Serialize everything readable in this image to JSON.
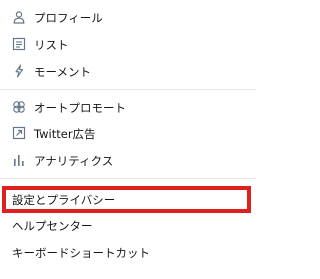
{
  "menu": {
    "items": [
      {
        "label": "プロフィール",
        "icon": "person-icon"
      },
      {
        "label": "リスト",
        "icon": "list-icon"
      },
      {
        "label": "モーメント",
        "icon": "lightning-icon"
      },
      {
        "label": "オートプロモート",
        "icon": "autopromote-icon"
      },
      {
        "label": "Twitter広告",
        "icon": "external-link-icon"
      },
      {
        "label": "アナリティクス",
        "icon": "bar-chart-icon"
      },
      {
        "label": "設定とプライバシー"
      },
      {
        "label": "ヘルプセンター"
      },
      {
        "label": "キーボードショートカット"
      }
    ]
  },
  "colors": {
    "icon": "#657786",
    "highlight_border": "#e0201e",
    "divider": "#e1e8ed"
  }
}
